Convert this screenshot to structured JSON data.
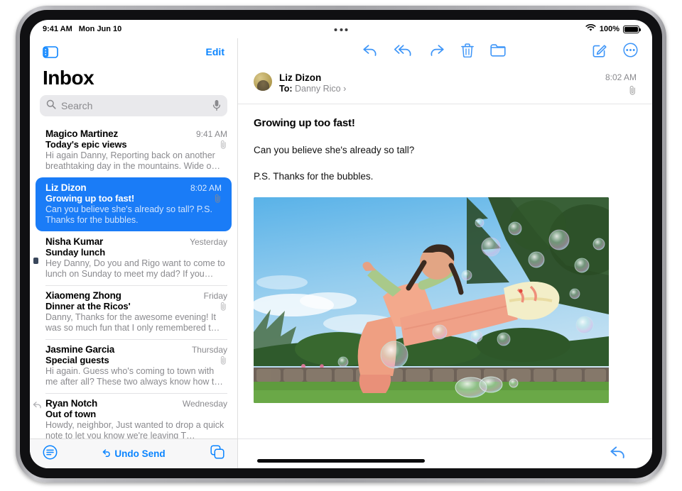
{
  "status_bar": {
    "time": "9:41 AM",
    "date": "Mon Jun 10",
    "battery_percent": "100%",
    "wifi_icon": "wifi-icon",
    "battery_icon": "battery-icon",
    "multitask_icon": "multitask-handle-icon"
  },
  "sidebar": {
    "toggle_icon": "sidebar-toggle-icon",
    "edit_label": "Edit",
    "title": "Inbox",
    "search": {
      "placeholder": "Search",
      "value": "Search",
      "search_icon": "search-icon",
      "mic_icon": "microphone-icon"
    },
    "messages": [
      {
        "sender": "Magico Martinez",
        "date": "9:41 AM",
        "subject": "Today's epic views",
        "preview": "Hi again Danny, Reporting back on another breathtaking day in the mountains. Wide o…",
        "has_attachment": true,
        "replied": false,
        "selected": false
      },
      {
        "sender": "Liz Dizon",
        "date": "8:02 AM",
        "subject": "Growing up too fast!",
        "preview": "Can you believe she's already so tall? P.S. Thanks for the bubbles.",
        "has_attachment": true,
        "replied": false,
        "selected": true
      },
      {
        "sender": "Nisha Kumar",
        "date": "Yesterday",
        "subject": "Sunday lunch",
        "preview": "Hey Danny, Do you and Rigo want to come to lunch on Sunday to meet my dad? If you…",
        "has_attachment": false,
        "replied": false,
        "selected": false
      },
      {
        "sender": "Xiaomeng Zhong",
        "date": "Friday",
        "subject": "Dinner at the Ricos'",
        "preview": "Danny, Thanks for the awesome evening! It was so much fun that I only remembered t…",
        "has_attachment": true,
        "replied": false,
        "selected": false
      },
      {
        "sender": "Jasmine Garcia",
        "date": "Thursday",
        "subject": "Special guests",
        "preview": "Hi again. Guess who's coming to town with me after all? These two always know how t…",
        "has_attachment": true,
        "replied": false,
        "selected": false
      },
      {
        "sender": "Ryan Notch",
        "date": "Wednesday",
        "subject": "Out of town",
        "preview": "Howdy, neighbor, Just wanted to drop a quick note to let you know we're leaving T…",
        "has_attachment": false,
        "replied": true,
        "selected": false
      }
    ],
    "toolbar": {
      "filter_icon": "filter-icon",
      "undo_send_label": "Undo Send",
      "undo_icon": "undo-arrow-icon",
      "compose_list_icon": "copy-icon"
    }
  },
  "detail": {
    "toolbar": {
      "reply_icon": "reply-icon",
      "reply_all_icon": "reply-all-icon",
      "forward_icon": "forward-icon",
      "trash_icon": "trash-icon",
      "move_icon": "folder-icon",
      "compose_icon": "compose-icon",
      "more_icon": "more-ellipsis-icon"
    },
    "header": {
      "avatar": "contact-avatar",
      "sender": "Liz Dizon",
      "to_label": "To:",
      "to_recipient": "Danny Rico",
      "disclosure_icon": "chevron-right-icon",
      "time": "8:02 AM",
      "attachment_icon": "paperclip-icon"
    },
    "body": {
      "subject": "Growing up too fast!",
      "paragraphs": [
        "Can you believe she's already so tall?",
        "P.S. Thanks for the bubbles."
      ],
      "photo_alt": "girl-kicking-with-bubbles-photo"
    },
    "bottom": {
      "reply_icon": "reply-icon"
    }
  },
  "colors": {
    "accent_blue": "#0a84ff",
    "selection_blue": "#1a7cf7",
    "secondary_text": "#8a8a8e"
  }
}
